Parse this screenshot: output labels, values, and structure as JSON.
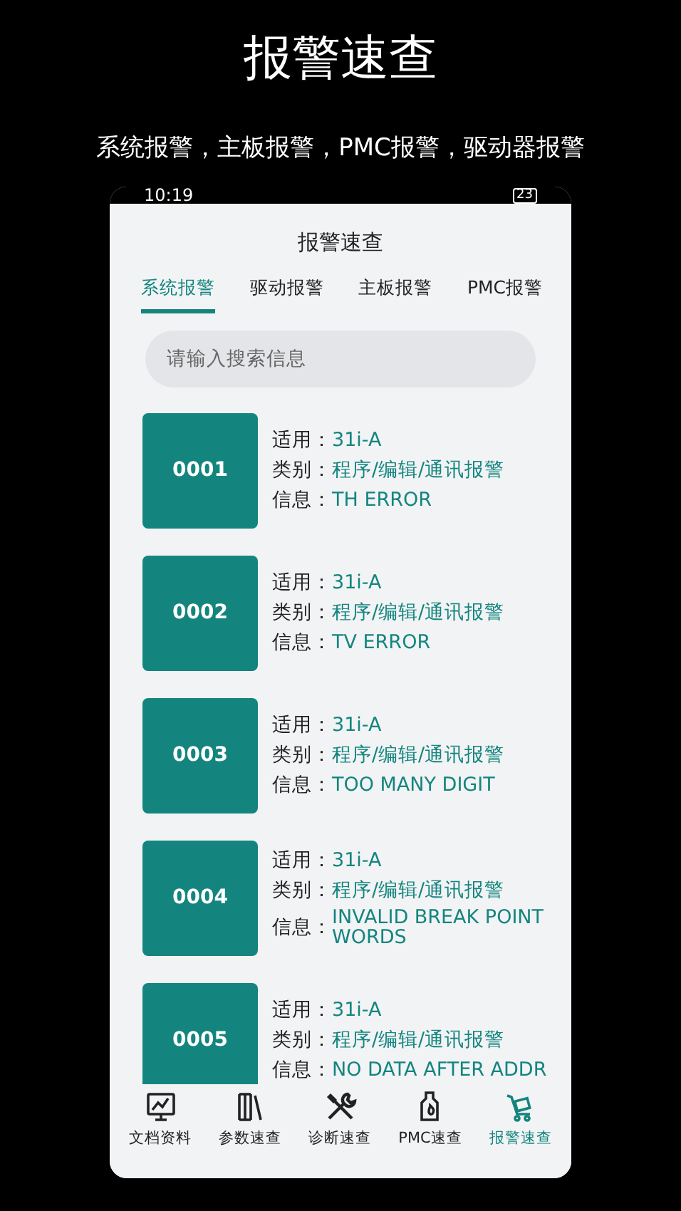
{
  "headline": "报警速查",
  "subtitle": "系统报警，主板报警，PMC报警，驱动器报警",
  "status_bar": {
    "time": "10:19",
    "battery": "23"
  },
  "app_title": "报警速查",
  "tabs": [
    {
      "label": "系统报警",
      "selected": true
    },
    {
      "label": "驱动报警",
      "selected": false
    },
    {
      "label": "主板报警",
      "selected": false
    },
    {
      "label": "PMC报警",
      "selected": false
    }
  ],
  "search": {
    "placeholder": "请输入搜索信息"
  },
  "alarms": [
    {
      "code": "0001",
      "fields": [
        {
          "label": "适用：",
          "value": "31i-A"
        },
        {
          "label": "类别：",
          "value": "程序/编辑/通讯报警"
        },
        {
          "label": "信息：",
          "value": "TH ERROR"
        }
      ]
    },
    {
      "code": "0002",
      "fields": [
        {
          "label": "适用：",
          "value": "31i-A"
        },
        {
          "label": "类别：",
          "value": "程序/编辑/通讯报警"
        },
        {
          "label": "信息：",
          "value": "TV ERROR"
        }
      ]
    },
    {
      "code": "0003",
      "fields": [
        {
          "label": "适用：",
          "value": "31i-A"
        },
        {
          "label": "类别：",
          "value": "程序/编辑/通讯报警"
        },
        {
          "label": "信息：",
          "value": "TOO MANY DIGIT"
        }
      ]
    },
    {
      "code": "0004",
      "fields": [
        {
          "label": "适用：",
          "value": "31i-A"
        },
        {
          "label": "类别：",
          "value": "程序/编辑/通讯报警"
        },
        {
          "label": "信息：",
          "value": "INVALID BREAK POINT WORDS"
        }
      ]
    },
    {
      "code": "0005",
      "fields": [
        {
          "label": "适用：",
          "value": "31i-A"
        },
        {
          "label": "类别：",
          "value": "程序/编辑/通讯报警"
        },
        {
          "label": "信息：",
          "value": "NO DATA AFTER ADDR"
        }
      ]
    }
  ],
  "bottom_nav": [
    {
      "kind": "chart",
      "label": "文档资料",
      "selected": false
    },
    {
      "kind": "books",
      "label": "参数速查",
      "selected": false
    },
    {
      "kind": "tools",
      "label": "诊断速查",
      "selected": false
    },
    {
      "kind": "bottle",
      "label": "PMC速查",
      "selected": false
    },
    {
      "kind": "cart",
      "label": "报警速查",
      "selected": true
    }
  ]
}
